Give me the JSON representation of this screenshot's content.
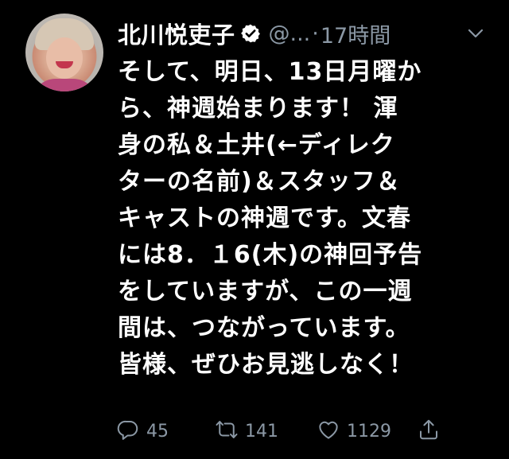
{
  "author": {
    "display_name": "北川悦吏子",
    "handle": "@...",
    "separator": "·",
    "timestamp": "17時間",
    "verified": true
  },
  "tweet": {
    "lines": [
      "そして、明日、13日月曜か",
      "ら、神週始まります！ 渾",
      "身の私＆土井(←ディレク",
      "ターの名前)＆スタッフ＆",
      "キャストの神週です。文春",
      "には8．１6(木)の神回予告",
      "をしていますが、この一週",
      "間は、つながっています。",
      "皆様、ぜひお見逃しなく！"
    ]
  },
  "actions": {
    "reply": {
      "icon": "reply-icon",
      "count": "45"
    },
    "retweet": {
      "icon": "retweet-icon",
      "count": "141"
    },
    "like": {
      "icon": "heart-icon",
      "count": "1129"
    },
    "share": {
      "icon": "share-icon"
    }
  },
  "colors": {
    "background": "#000000",
    "text": "#ffffff",
    "muted": "#8b98a5"
  }
}
